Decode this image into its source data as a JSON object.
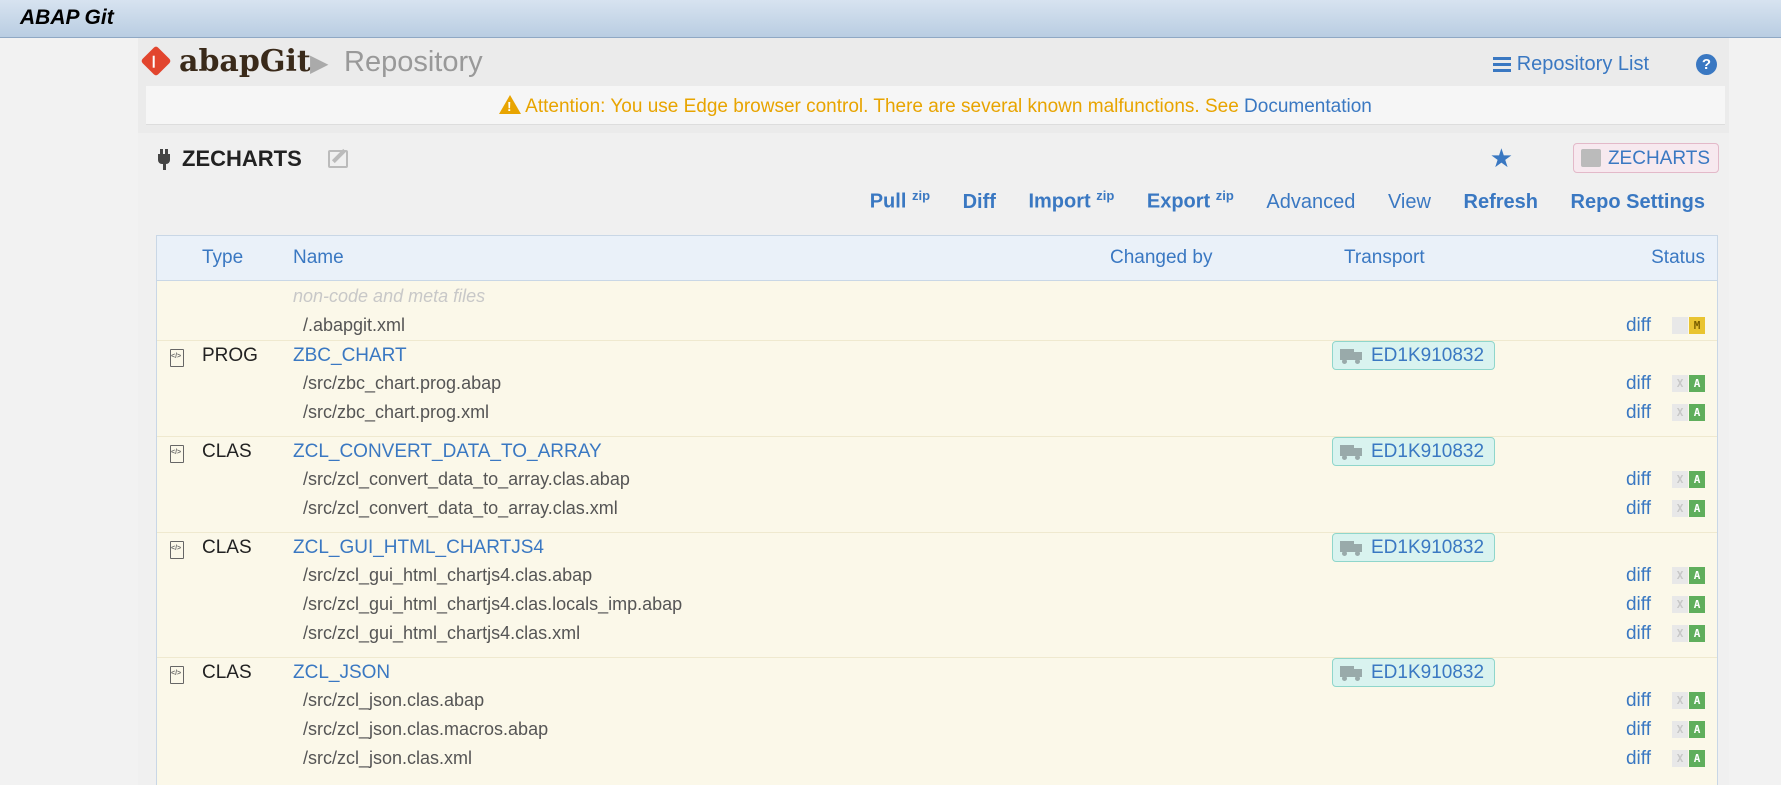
{
  "window": {
    "title": "ABAP Git"
  },
  "header": {
    "app_name": "abapGit",
    "crumb_arrow": "▶",
    "page": "Repository",
    "repo_list": "Repository List",
    "help": "?"
  },
  "warning": {
    "text": "Attention: You use Edge browser control. There are several known malfunctions. See ",
    "link": "Documentation"
  },
  "repo": {
    "name": "ZECHARTS",
    "package": "ZECHARTS"
  },
  "toolbar": {
    "pull": "Pull",
    "pull_sup": "zip",
    "diff": "Diff",
    "import": "Import",
    "import_sup": "zip",
    "export": "Export",
    "export_sup": "zip",
    "advanced": "Advanced",
    "view": "View",
    "refresh": "Refresh",
    "repo_settings": "Repo Settings"
  },
  "table": {
    "headers": {
      "type": "Type",
      "name": "Name",
      "changed_by": "Changed by",
      "transport": "Transport",
      "status": "Status"
    },
    "meta_label": "non-code and meta files",
    "rows": [
      {
        "kind": "file",
        "file": "/.abapgit.xml",
        "diff": "diff",
        "s1": "",
        "s2": "M"
      },
      {
        "kind": "obj",
        "type": "PROG",
        "name": "ZBC_CHART",
        "transport": "ED1K910832"
      },
      {
        "kind": "file",
        "file": "/src/zbc_chart.prog.abap",
        "diff": "diff",
        "s1": "X",
        "s2": "A"
      },
      {
        "kind": "file",
        "file": "/src/zbc_chart.prog.xml",
        "diff": "diff",
        "s1": "X",
        "s2": "A"
      },
      {
        "kind": "obj",
        "type": "CLAS",
        "name": "ZCL_CONVERT_DATA_TO_ARRAY",
        "transport": "ED1K910832"
      },
      {
        "kind": "file",
        "file": "/src/zcl_convert_data_to_array.clas.abap",
        "diff": "diff",
        "s1": "X",
        "s2": "A"
      },
      {
        "kind": "file",
        "file": "/src/zcl_convert_data_to_array.clas.xml",
        "diff": "diff",
        "s1": "X",
        "s2": "A"
      },
      {
        "kind": "obj",
        "type": "CLAS",
        "name": "ZCL_GUI_HTML_CHARTJS4",
        "transport": "ED1K910832"
      },
      {
        "kind": "file",
        "file": "/src/zcl_gui_html_chartjs4.clas.abap",
        "diff": "diff",
        "s1": "X",
        "s2": "A"
      },
      {
        "kind": "file",
        "file": "/src/zcl_gui_html_chartjs4.clas.locals_imp.abap",
        "diff": "diff",
        "s1": "X",
        "s2": "A"
      },
      {
        "kind": "file",
        "file": "/src/zcl_gui_html_chartjs4.clas.xml",
        "diff": "diff",
        "s1": "X",
        "s2": "A"
      },
      {
        "kind": "obj",
        "type": "CLAS",
        "name": "ZCL_JSON",
        "transport": "ED1K910832"
      },
      {
        "kind": "file",
        "file": "/src/zcl_json.clas.abap",
        "diff": "diff",
        "s1": "X",
        "s2": "A"
      },
      {
        "kind": "file",
        "file": "/src/zcl_json.clas.macros.abap",
        "diff": "diff",
        "s1": "X",
        "s2": "A"
      },
      {
        "kind": "file",
        "file": "/src/zcl_json.clas.xml",
        "diff": "diff",
        "s1": "X",
        "s2": "A"
      }
    ]
  }
}
